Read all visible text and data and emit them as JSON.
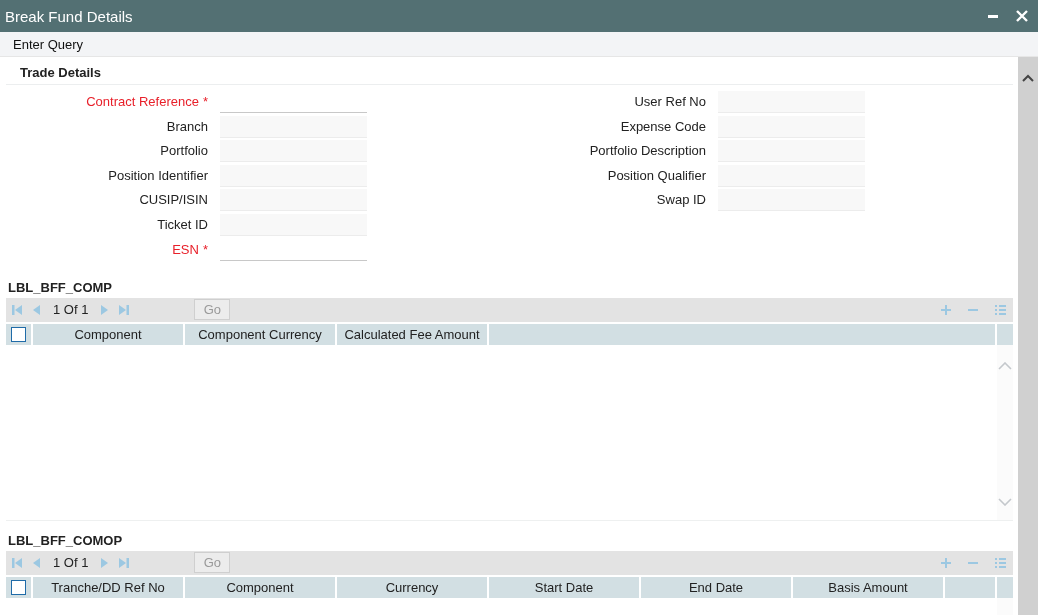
{
  "window": {
    "title": "Break Fund Details"
  },
  "menu": [
    "Enter Query"
  ],
  "section": {
    "title": "Trade Details",
    "left_fields": [
      {
        "label": "Contract Reference",
        "required": true,
        "marker": "*"
      },
      {
        "label": "Branch",
        "required": false
      },
      {
        "label": "Portfolio",
        "required": false
      },
      {
        "label": "Position Identifier",
        "required": false
      },
      {
        "label": "CUSIP/ISIN",
        "required": false
      },
      {
        "label": "Ticket ID",
        "required": false
      },
      {
        "label": "ESN",
        "required": true,
        "marker": "*"
      }
    ],
    "right_fields": [
      {
        "label": "User Ref No",
        "required": false
      },
      {
        "label": "Expense Code",
        "required": false
      },
      {
        "label": "Portfolio Description",
        "required": false
      },
      {
        "label": "Position Qualifier",
        "required": false
      },
      {
        "label": "Swap ID",
        "required": false
      }
    ]
  },
  "grids": [
    {
      "title": "LBL_BFF_COMP",
      "pager": "1 Of 1",
      "go": "Go",
      "select_all": {
        "checked": false
      },
      "columns": [
        "Component",
        "Component Currency",
        "Calculated Fee Amount"
      ]
    },
    {
      "title": "LBL_BFF_COMOP",
      "pager": "1 Of 1",
      "go": "Go",
      "select_all": {
        "checked": false
      },
      "columns": [
        "Tranche/DD Ref No",
        "Component",
        "Currency",
        "Start Date",
        "End Date",
        "Basis Amount"
      ]
    }
  ]
}
